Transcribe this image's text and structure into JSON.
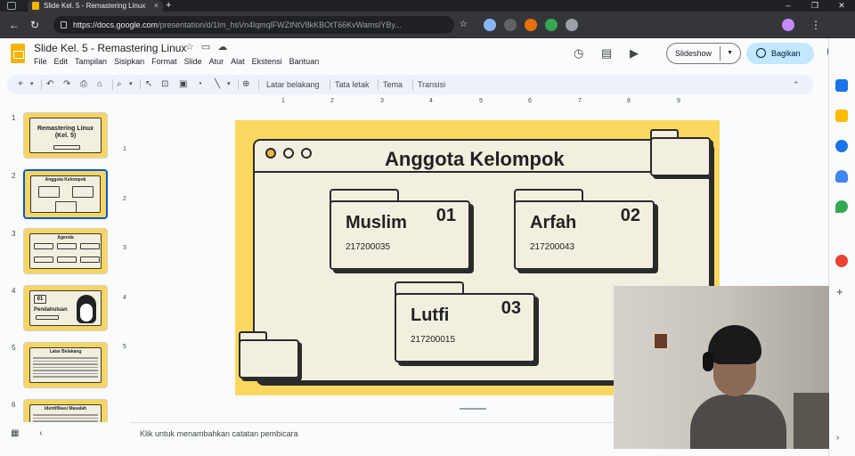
{
  "browser": {
    "tab_title": "Slide Kel. 5 - Remastering Linux",
    "tab_close": "×",
    "new_tab": "+",
    "url_host": "https://docs.google.com",
    "url_path": "/presentation/d/1lm_hsVn4lqmqlFWZtNtV8kKBOtT66KvWamsIYBy...",
    "window_controls": [
      "–",
      "❐",
      "✕"
    ]
  },
  "app": {
    "doc_title": "Slide Kel. 5 - Remastering Linux",
    "menus": [
      "File",
      "Edit",
      "Tampilan",
      "Sisipkan",
      "Format",
      "Slide",
      "Atur",
      "Alat",
      "Ekstensi",
      "Bantuan"
    ],
    "slideshow_label": "Slideshow",
    "share_label": "Bagikan"
  },
  "toolbar": {
    "background_label": "Latar belakang",
    "layout_label": "Tata letak",
    "theme_label": "Tema",
    "transition_label": "Transisi"
  },
  "filmstrip": {
    "numbers": [
      "1",
      "2",
      "3",
      "4",
      "5",
      "6"
    ],
    "slide1_title": "Remastering Linux (Kel. 5)",
    "slide2_title": "Anggota Kelompok",
    "slide3_title": "Agenda",
    "slide4_num": "01",
    "slide4_title": "Pendahuluan",
    "slide5_title": "Latar Belakang",
    "slide6_title": "Identifikasi Masalah"
  },
  "rulers": {
    "top": [
      "1",
      "2",
      "3",
      "4",
      "5",
      "6",
      "7",
      "8",
      "9"
    ],
    "left": [
      "1",
      "2",
      "3",
      "4",
      "5"
    ]
  },
  "slide": {
    "title": "Anggota Kelompok",
    "members": [
      {
        "name": "Muslim",
        "number": "01",
        "id": "217200035"
      },
      {
        "name": "Arfah",
        "number": "02",
        "id": "217200043"
      },
      {
        "name": "Lutfi",
        "number": "03",
        "id": "217200015"
      }
    ]
  },
  "notes": {
    "placeholder": "Klik untuk menambahkan catatan pembicara"
  },
  "colors": {
    "slide_bg": "#fad860",
    "panel_bg": "#f3efe0",
    "outline": "#2b2b2b",
    "accent_blue": "#0b57d0",
    "share_bg": "#c2e7ff"
  }
}
